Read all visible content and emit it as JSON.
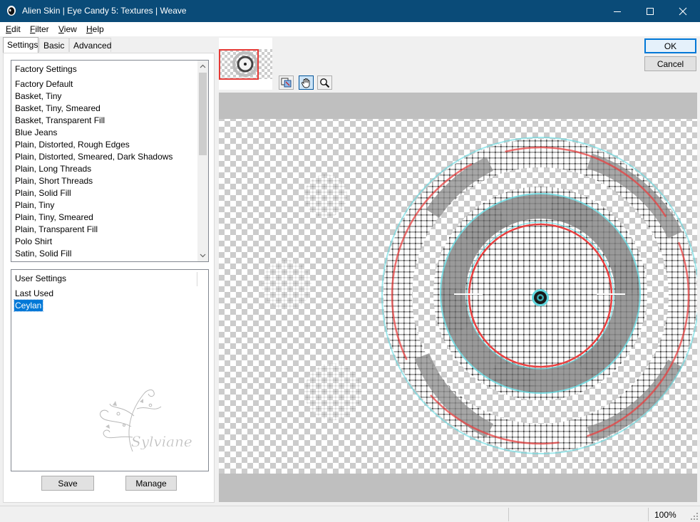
{
  "window": {
    "title": "Alien Skin | Eye Candy 5: Textures | Weave",
    "minimize_glyph": "—",
    "maximize_glyph": "☐",
    "close_glyph": "✕",
    "titlebar_color": "#0a4b78"
  },
  "menu": [
    {
      "underline": "E",
      "rest": "dit"
    },
    {
      "underline": "F",
      "rest": "ilter"
    },
    {
      "underline": "V",
      "rest": "iew"
    },
    {
      "underline": "H",
      "rest": "elp"
    }
  ],
  "tabs": [
    "Settings",
    "Basic",
    "Advanced"
  ],
  "factory_settings": {
    "header": "Factory Settings",
    "items": [
      "Factory Default",
      "Basket, Tiny",
      "Basket, Tiny, Smeared",
      "Basket, Transparent Fill",
      "Blue Jeans",
      "Plain, Distorted, Rough Edges",
      "Plain, Distorted, Smeared, Dark Shadows",
      "Plain, Long Threads",
      "Plain, Short Threads",
      "Plain, Solid Fill",
      "Plain, Tiny",
      "Plain, Tiny, Smeared",
      "Plain, Transparent Fill",
      "Polo Shirt",
      "Satin, Solid Fill"
    ]
  },
  "user_settings": {
    "header": "User Settings",
    "items": [
      "Last Used",
      "Ceylan"
    ],
    "selected_index": 1
  },
  "watermark_text": "Sylviane",
  "buttons": {
    "save": "Save",
    "manage": "Manage",
    "ok": "OK",
    "cancel": "Cancel"
  },
  "tools": [
    "preview-toggle-icon",
    "hand-icon",
    "zoom-icon"
  ],
  "status": {
    "zoom": "100%"
  },
  "colors": {
    "accent": "#0078d7",
    "ring_red": "#e84040",
    "ring_cyan": "#5fd8e0"
  }
}
